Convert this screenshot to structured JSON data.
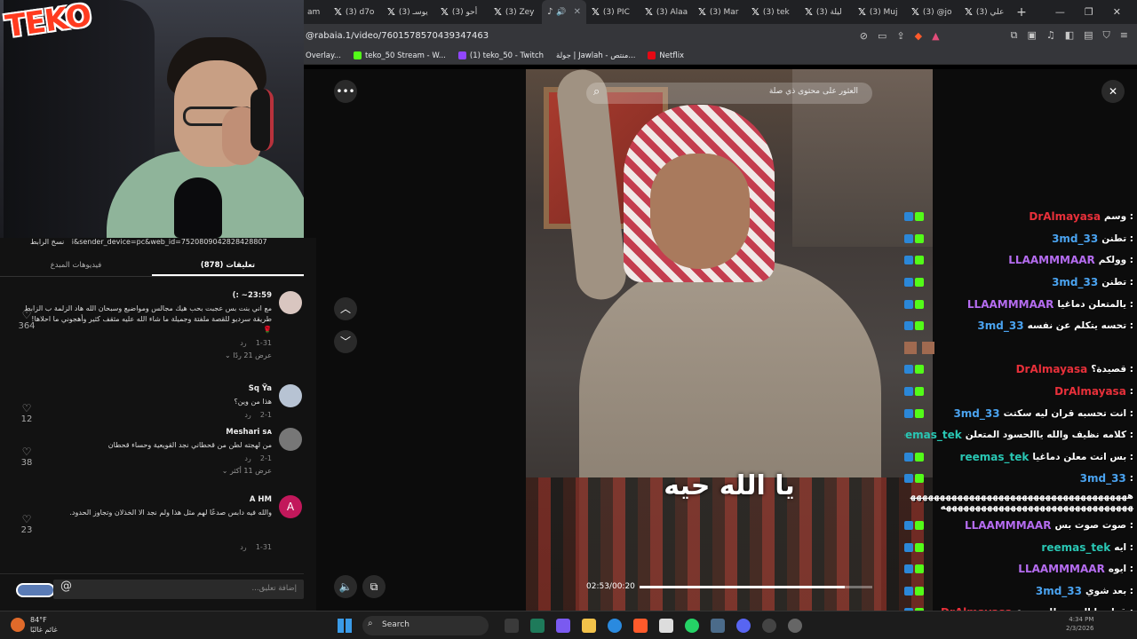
{
  "browser": {
    "tabs": [
      "am",
      "(3) d7o",
      "(3) يوسـ",
      "(3) أحو",
      "(3) Zey",
      "",
      "(3) PIC",
      "(3) Alaa",
      "(3) Mar",
      "(3) tek",
      "(3) ليلة",
      "(3) Muj",
      "(3) @jo",
      "(3) علي"
    ],
    "active_tab_index": 5,
    "url": "@rabaia.1/video/7601578570439347463",
    "bookmarks": [
      "Overlay...",
      "teko_50 Stream - W...",
      "(1) teko_50 - Twitch",
      "جولة | Jawlah - منتص...",
      "Netflix"
    ]
  },
  "stream": {
    "logo": "TEKO"
  },
  "comments_panel": {
    "share_url": "i&sender_device=pc&web_id=7520809042828428807",
    "share_label": "نسخ الرابط",
    "tab_comments": "تعليقات (878)",
    "tab_creator_videos": "فيديوهات المبدع",
    "comments": [
      {
        "user": "23:59~ :)",
        "text": "مع اني بنت بس عجبت بحب هيك مجالس ومواضيع وسبحان الله هاد الزلمة ب الزابط طريقة سرديو للقصة ملفتة وجميلة ما شاء الله عليه مثقف كثير وأهجوني ما احلاها! 🌹",
        "date": "1-31",
        "reply": "رد",
        "more": "عرض 21 ردًا",
        "likes": "364",
        "avatar_color": "#d9c6c0"
      },
      {
        "user": "Sq Ÿa",
        "text": "هذا من وين؟",
        "date": "2-1",
        "reply": "رد",
        "more": "",
        "likes": "12",
        "avatar_color": "#b7c3d3"
      },
      {
        "user": "Meshari sᴀ",
        "text": "من لهجته لطن من قحطاني نجد القويعية وحساء قحطان",
        "date": "2-1",
        "reply": "رد",
        "more": "عرض 11 أكثر",
        "likes": "38",
        "avatar_color": "#777777"
      },
      {
        "user": "A HM",
        "text": "والله فيه دابس صدعًا لهم مثل هذا ولم نجد الا الخذلان وتجاوز الحدود.",
        "date": "1-31",
        "reply": "رد",
        "more": "",
        "likes": "23",
        "avatar_color": "#c2185b",
        "avatar_letter": "A"
      }
    ],
    "add_comment_placeholder": "إضافة تعليق..."
  },
  "video": {
    "search_placeholder": "العثور على محتوى ذي صلة",
    "caption": "يا الله حيه",
    "time": "02:53/00:20",
    "progress": 0.88
  },
  "chat": [
    {
      "name": "DrAlmayasa",
      "msg": "وسم",
      "color": "#e8303a"
    },
    {
      "name": "3md_33",
      "msg": "تطنن",
      "color": "#4aa3f0"
    },
    {
      "name": "LLAAMMMAAR",
      "msg": "وولكم",
      "color": "#b56cf0"
    },
    {
      "name": "3md_33",
      "msg": "تطنن",
      "color": "#4aa3f0"
    },
    {
      "name": "LLAAMMMAAR",
      "msg": "يالمتعلن دماغيا",
      "color": "#b56cf0"
    },
    {
      "name": "3md_33",
      "msg": "تحسه يتكلم عن نفسه",
      "color": "#4aa3f0"
    },
    {
      "name": "",
      "msg": "",
      "color": "#ffffff"
    },
    {
      "name": "DrAlmayasa",
      "msg": "قصيدة؟",
      "color": "#e8303a"
    },
    {
      "name": "DrAlmayasa",
      "msg": "",
      "color": "#e8303a"
    },
    {
      "name": "3md_33",
      "msg": "انت تحسبه قران ليه سكتت",
      "color": "#4aa3f0"
    },
    {
      "name": "reemas_tek",
      "msg": "كلامه نظيف والله ياالحسود المتعلن",
      "color": "#29c7b4"
    },
    {
      "name": "reemas_tek",
      "msg": "بس انت معلن دماغيا",
      "color": "#29c7b4"
    },
    {
      "name": "3md_33",
      "msg": "",
      "color": "#4aa3f0"
    },
    {
      "name": "",
      "msg": "ههههههههههههههههههههههههههههههههههههههههههههههههههههههههههههههههههههههه",
      "color": "#ffffff"
    },
    {
      "name": "LLAAMMMAAR",
      "msg": "صوت صوت بس",
      "color": "#b56cf0"
    },
    {
      "name": "reemas_tek",
      "msg": "ايه",
      "color": "#29c7b4"
    },
    {
      "name": "LLAAMMMAAR",
      "msg": "ايوه",
      "color": "#b56cf0"
    },
    {
      "name": "3md_33",
      "msg": "بعد شوي",
      "color": "#4aa3f0"
    },
    {
      "name": "DrAlmayasa",
      "msg": "قول ما الحبيت للموضوع",
      "color": "#e8303a"
    }
  ],
  "taskbar": {
    "temperature": "84°F",
    "weather_desc": "غائم غالبًا",
    "search_label": "Search",
    "time": "4:34 PM",
    "date": "2/3/2026"
  }
}
